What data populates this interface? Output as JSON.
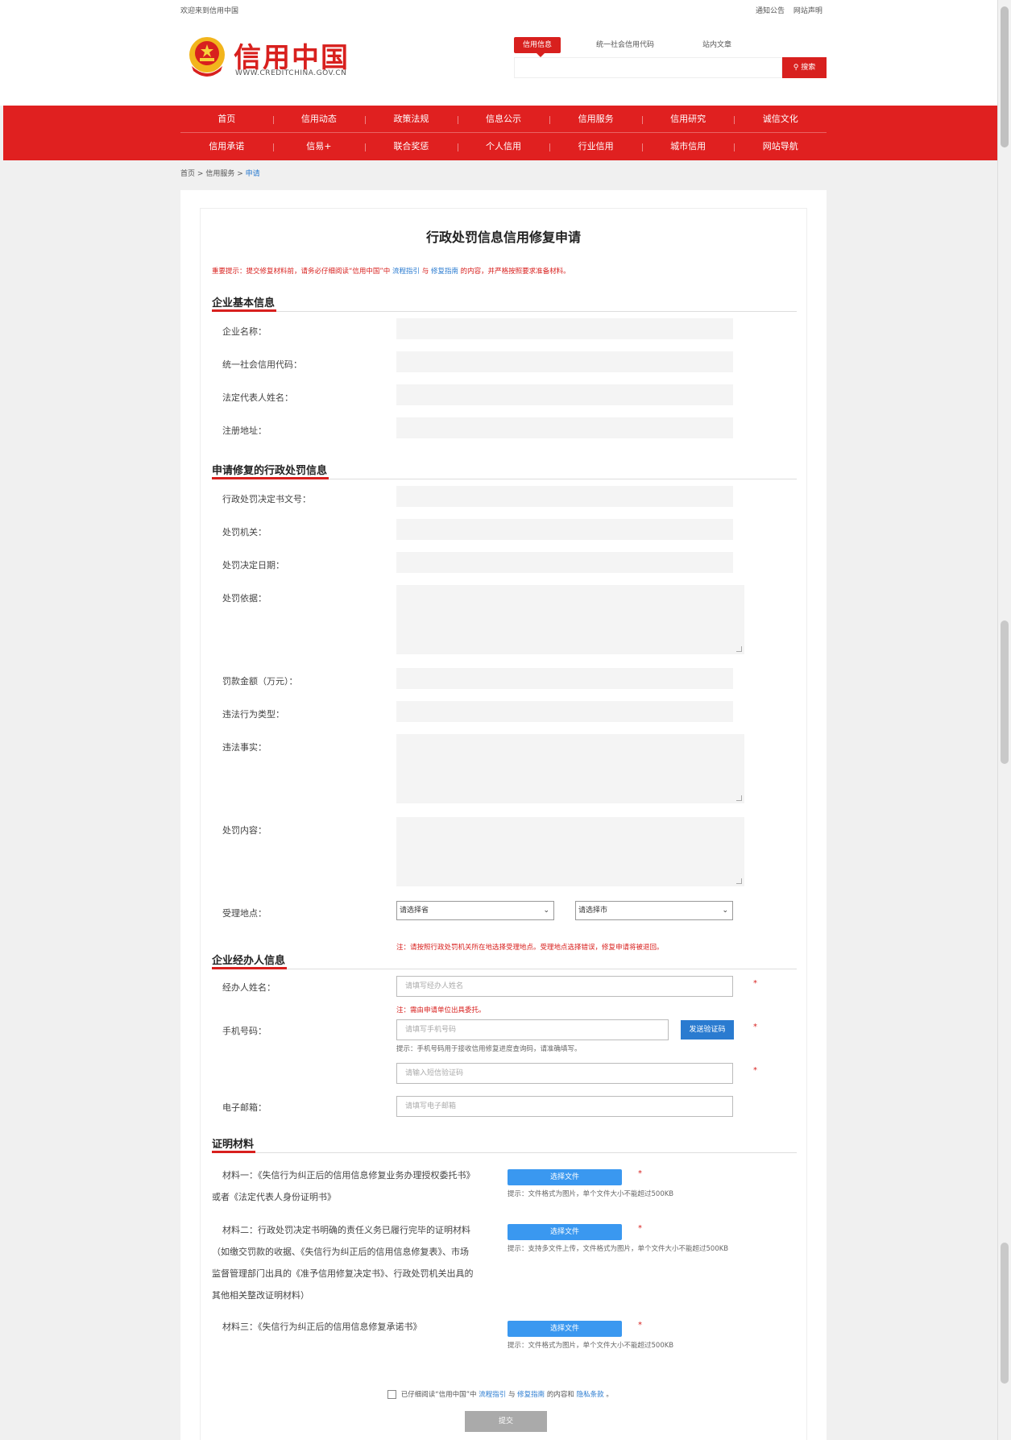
{
  "topbar": {
    "welcome": "欢迎来到信用中国",
    "links": [
      "通知公告",
      "网站声明"
    ]
  },
  "brand": {
    "name": "信用中国",
    "url": "WWW.CREDITCHINA.GOV.CN"
  },
  "search": {
    "tabs": [
      "信用信息",
      "统一社会信用代码",
      "站内文章"
    ],
    "button": "搜索",
    "placeholder": ""
  },
  "nav": {
    "row1": [
      "首页",
      "信用动态",
      "政策法规",
      "信息公示",
      "信用服务",
      "信用研究",
      "诚信文化"
    ],
    "row2": [
      "信用承诺",
      "信易+",
      "联合奖惩",
      "个人信用",
      "行业信用",
      "城市信用",
      "网站导航"
    ]
  },
  "breadcrumb": {
    "home": "首页",
    "sep": ">",
    "level1": "信用服务",
    "current": "申请"
  },
  "form": {
    "title": "行政处罚信息信用修复申请",
    "notice": {
      "prefix": "重要提示：提交修复材料前，请务必仔细阅读“信用中国”中",
      "link1": "流程指引",
      "mid": "与",
      "link2": "修复指南",
      "suffix": "的内容，并严格按照要求准备材料。"
    },
    "section1": {
      "title": "企业基本信息",
      "fields": [
        "企业名称：",
        "统一社会信用代码：",
        "法定代表人姓名：",
        "注册地址："
      ]
    },
    "section2": {
      "title": "申请修复的行政处罚信息",
      "fields": {
        "doc_no": "行政处罚决定书文号：",
        "authority": "处罚机关：",
        "date": "处罚决定日期：",
        "basis": "处罚依据：",
        "amount": "罚款金额（万元）：",
        "type": "违法行为类型：",
        "facts": "违法事实：",
        "content": "处罚内容：",
        "location": "受理地点："
      },
      "province": "请选择省",
      "city": "请选择市",
      "location_note": "注：请按照行政处罚机关所在地选择受理地点。受理地点选择错误，修复申请将被退回。"
    },
    "section3": {
      "title": "企业经办人信息",
      "name_label": "经办人姓名：",
      "name_placeholder": "请填写经办人姓名",
      "name_note": "注：需由申请单位出具委托。",
      "phone_label": "手机号码：",
      "phone_placeholder": "请填写手机号码",
      "send_code": "发送验证码",
      "phone_hint": "提示：手机号码用于接收信用修复进度查询码，请准确填写。",
      "code_placeholder": "请输入短信验证码",
      "email_label": "电子邮箱：",
      "email_placeholder": "请填写电子邮箱",
      "required": "*"
    },
    "section4": {
      "title": "证明材料",
      "file_button": "选择文件",
      "materials": [
        {
          "lines": [
            "材料一：《失信行为纠正后的信用信息修复业务办理授权委托书》",
            "或者《法定代表人身份证明书》"
          ],
          "hint": "提示：文件格式为图片，单个文件大小不能超过500KB"
        },
        {
          "lines": [
            "材料二：行政处罚决定书明确的责任义务已履行完毕的证明材料",
            "（如缴交罚款的收据、《失信行为纠正后的信用信息修复表》、市场",
            "监督管理部门出具的《准予信用修复决定书》、行政处罚机关出具的",
            "其他相关整改证明材料）"
          ],
          "hint": "提示：支持多文件上传，文件格式为图片，单个文件大小不能超过500KB"
        },
        {
          "lines": [
            "材料三：《失信行为纠正后的信用信息修复承诺书》"
          ],
          "hint": "提示：文件格式为图片，单个文件大小不能超过500KB"
        }
      ]
    },
    "agree": {
      "prefix": "已仔细阅读“信用中国”中",
      "link1": "流程指引",
      "mid": "与",
      "link2": "修复指南",
      "mid2": "的内容和",
      "link3": "隐私条款",
      "suffix": "。"
    },
    "submit": "提交"
  },
  "colors": {
    "brand_red": "#d8201e",
    "nav_red": "#e02020",
    "link_blue": "#2a7bd0"
  }
}
